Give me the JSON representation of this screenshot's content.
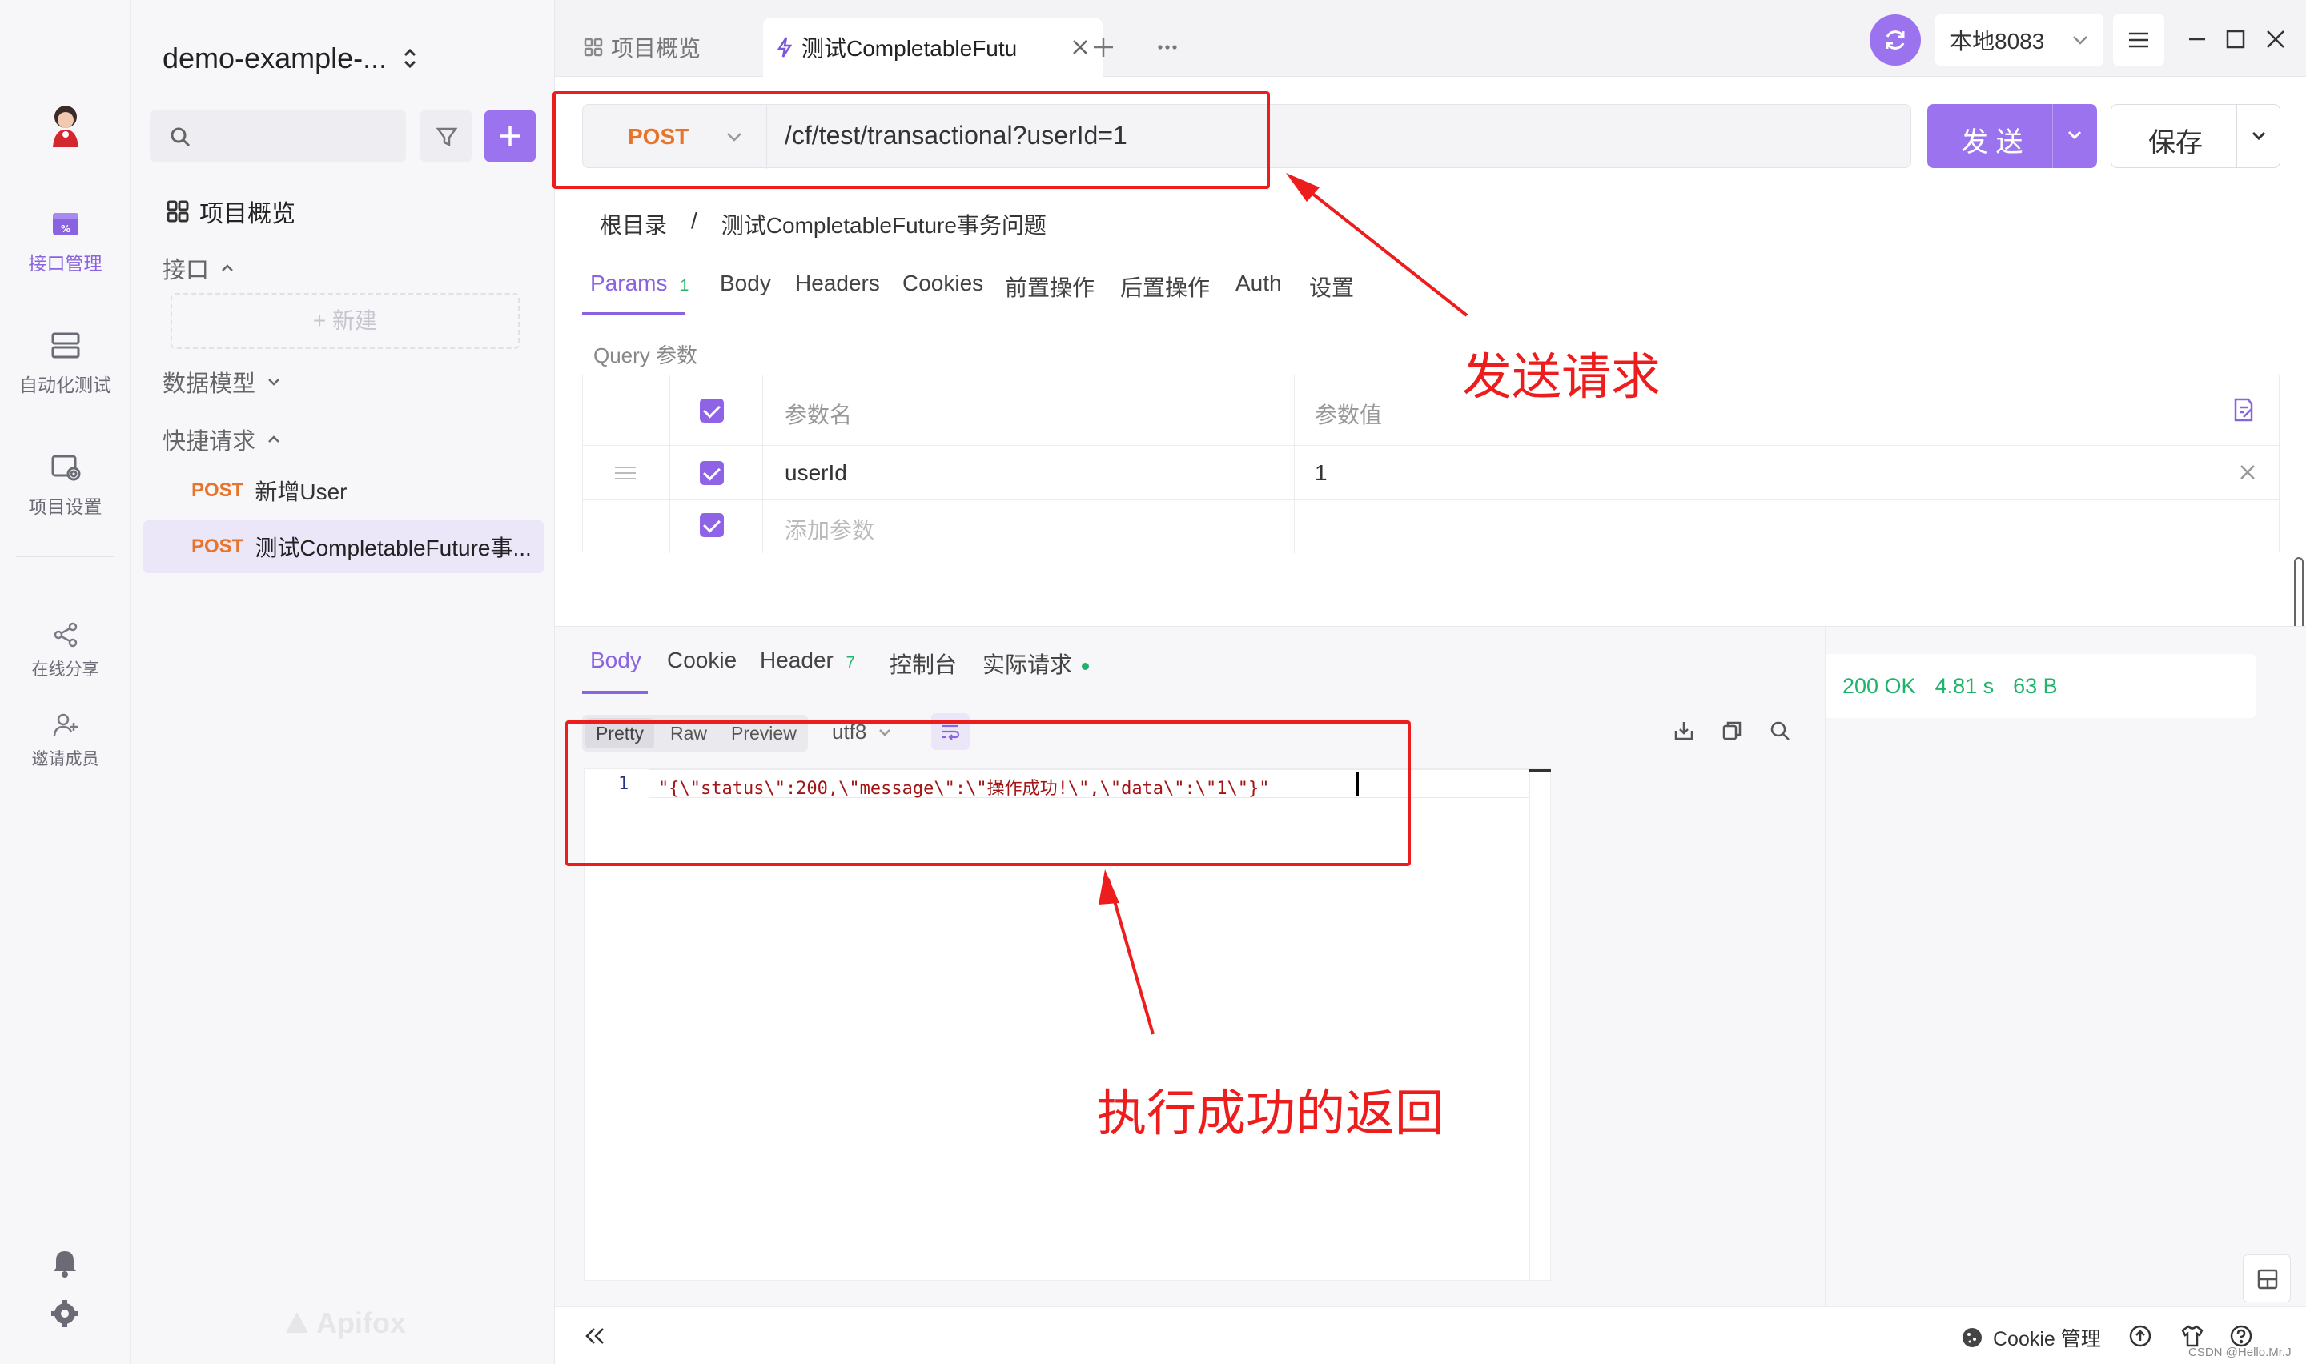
{
  "app": {
    "project_name": "demo-example-...",
    "logo_text": "Apifox"
  },
  "rail": {
    "items": [
      {
        "label": "接口管理",
        "active": true
      },
      {
        "label": "自动化测试"
      },
      {
        "label": "项目设置"
      },
      {
        "label": "在线分享"
      },
      {
        "label": "邀请成员"
      }
    ]
  },
  "nav": {
    "overview": "项目概览",
    "section_api": "接口",
    "new_button": "+ 新建",
    "section_models": "数据模型",
    "section_quick": "快捷请求",
    "quick_items": [
      {
        "method": "POST",
        "name": "新增User"
      },
      {
        "method": "POST",
        "name": "测试CompletableFuture事..."
      }
    ]
  },
  "tabs": {
    "overview_tab": "项目概览",
    "active_tab": "测试CompletableFutu",
    "env": "本地8083"
  },
  "request": {
    "method": "POST",
    "url": "/cf/test/transactional?userId=1",
    "send_label": "发 送",
    "save_label": "保存",
    "breadcrumb_root": "根目录",
    "breadcrumb_sep": "/",
    "breadcrumb_name": "测试CompletableFuture事务问题"
  },
  "request_tabs": [
    {
      "label": "Params",
      "badge": "1",
      "active": true
    },
    {
      "label": "Body"
    },
    {
      "label": "Headers"
    },
    {
      "label": "Cookies"
    },
    {
      "label": "前置操作"
    },
    {
      "label": "后置操作"
    },
    {
      "label": "Auth"
    },
    {
      "label": "设置"
    }
  ],
  "params": {
    "section_label": "Query 参数",
    "col_name": "参数名",
    "col_value": "参数值",
    "rows": [
      {
        "name": "userId",
        "value": "1"
      }
    ],
    "add_placeholder": "添加参数"
  },
  "response_tabs": [
    {
      "label": "Body",
      "active": true
    },
    {
      "label": "Cookie"
    },
    {
      "label": "Header",
      "badge": "7"
    },
    {
      "label": "控制台"
    },
    {
      "label": "实际请求"
    }
  ],
  "response": {
    "view_modes": [
      "Pretty",
      "Raw",
      "Preview"
    ],
    "encoding": "utf8",
    "line_number": "1",
    "body": "\"{\\\"status\\\":200,\\\"message\\\":\\\"操作成功!\\\",\\\"data\\\":\\\"1\\\"}\"",
    "status": "200 OK",
    "time": "4.81 s",
    "size": "63 B"
  },
  "footer": {
    "cookie_manage": "Cookie 管理",
    "watermark": "CSDN @Hello.Mr.J"
  },
  "annotations": {
    "send_request": "发送请求",
    "success_return": "执行成功的返回"
  },
  "colors": {
    "accent": "#9b73ee",
    "post_method": "#e8742c",
    "annotation_red": "#ee1d1d",
    "status_green": "#21b36b"
  }
}
